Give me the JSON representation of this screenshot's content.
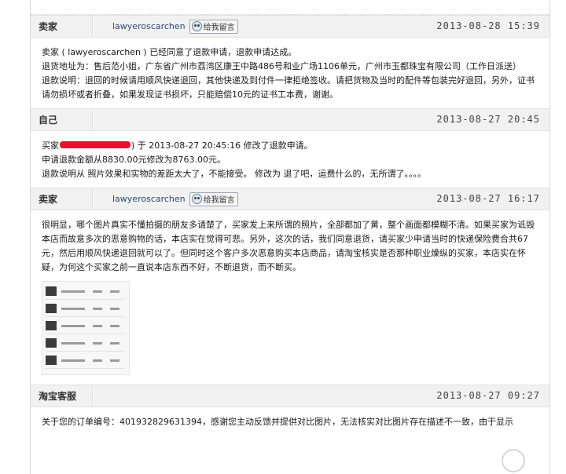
{
  "colors": {
    "header_bg": "#f1f1f1",
    "link": "#2d4b7c",
    "redaction": "#e8122d"
  },
  "messages": [
    {
      "author": "卖家",
      "seller_link": "lawyeroscarchen",
      "leave_msg_label": "给我留言",
      "timestamp": "2013-08-28  15:39",
      "lines": [
        "卖家 ( lawyeroscarchen ) 已经同意了退款申请，退款申请达成。",
        "退货地址为：售后范小姐，广东省广州市荔湾区康王中路486号和业广场1106单元，广州市玉都珠宝有限公司（工作日派送）",
        "退款说明：退回的时候请用顺风快递退回，其他快递及到付件一律拒绝签收。请把货物及当时的配件等包装完好退回，另外，证书请勿损坏或者折叠，如果发现证书损坏，只能赔偿10元的证书工本费，谢谢。"
      ]
    },
    {
      "author": "自己",
      "timestamp": "2013-08-27  20:45",
      "lines_prefix": "买家",
      "lines_rest": ") 于 2013-08-27 20:45:16 修改了退款申请。",
      "lines": [
        "申请退款金额从8830.00元修改为8763.00元。",
        "退款说明从 照片效果和实物的差距太大了，不能接受。 修改为 退了吧，运费什么的，无所谓了。。。。"
      ]
    },
    {
      "author": "卖家",
      "seller_link": "lawyeroscarchen",
      "leave_msg_label": "给我留言",
      "timestamp": "2013-08-27  16:17",
      "lines": [
        "很明显，哪个图片真实不懂拍摄的朋友多请楚了，买家发上来所谓的照片，全部都加了黄，整个画面都模糊不清。如果买家为诋毁本店而故意多次的恶意购物的话，本店实在觉得可悲。另外，这次的话，我们同意退货，请买家少申请当时的快递保险费合共67元，然后用顺风快递退回就可以了。但同时这个客户多次恶意购买本店商品，请淘宝核实是否那种职业燥纵的买家，本店实在怀疑，为何这个买家之前一直说本店东西不好，不断退货，而不断买。"
      ]
    },
    {
      "author": "淘宝客服",
      "timestamp": "2013-08-27  09:27",
      "lines": [
        "关于您的订单编号：401932829631394，感谢您主动反馈并提供对比图片，无法核实对比图片存在描述不一致，由于显示"
      ]
    }
  ]
}
